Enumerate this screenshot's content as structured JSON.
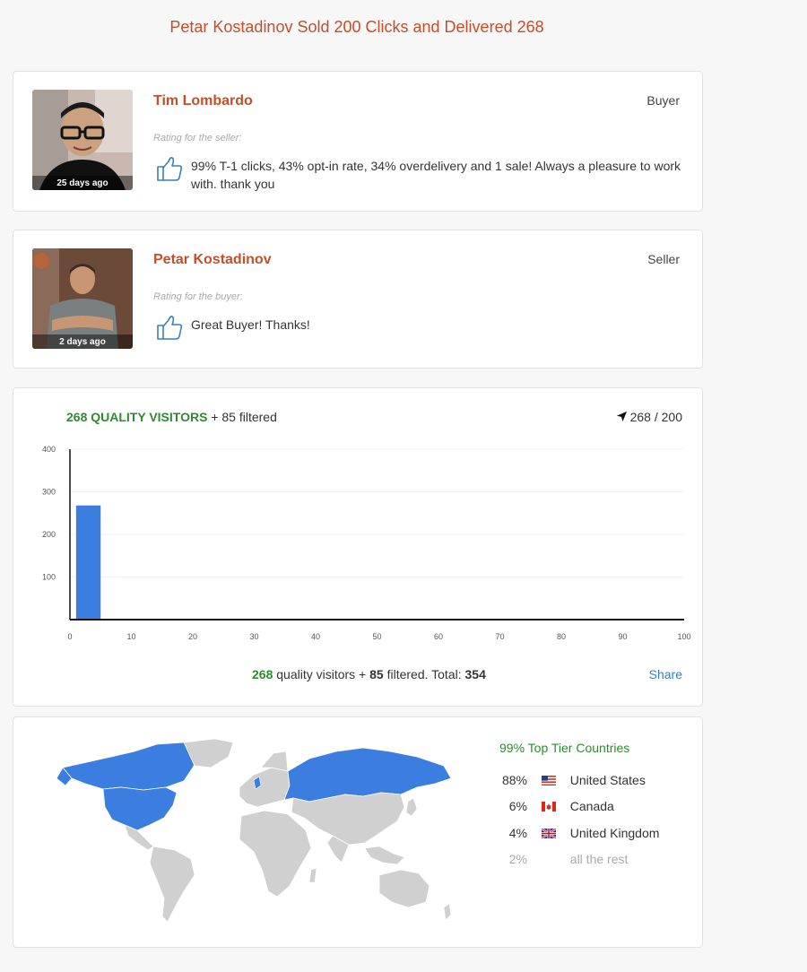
{
  "page": {
    "title": "Petar Kostadinov Sold 200 Clicks and Delivered 268"
  },
  "reviews": [
    {
      "name": "Tim Lombardo",
      "role": "Buyer",
      "time_ago": "25 days ago",
      "rating_label": "Rating for the seller:",
      "comment": "99% T-1 clicks, 43% opt-in rate, 34% overdelivery and 1 sale! Always a pleasure to work with. thank you",
      "rating_icon": "thumbs-up-icon"
    },
    {
      "name": "Petar Kostadinov",
      "role": "Seller",
      "time_ago": "2 days ago",
      "rating_label": "Rating for the buyer:",
      "comment": "Great Buyer! Thanks!",
      "rating_icon": "thumbs-up-icon"
    }
  ],
  "visitors": {
    "quality_label": "268 QUALITY VISITORS",
    "filtered_label": "+ 85 filtered",
    "delivered_label": "268 / 200",
    "footer": {
      "quality": "268",
      "quality_text": "quality visitors +",
      "filtered": "85",
      "filtered_text": "filtered. Total:",
      "total": "354"
    },
    "share_label": "Share"
  },
  "chart_data": {
    "type": "bar",
    "x": [
      3
    ],
    "values": [
      268
    ],
    "xlim": [
      0,
      100
    ],
    "ylim": [
      0,
      400
    ],
    "x_ticks": [
      "0",
      "10",
      "20",
      "30",
      "40",
      "50",
      "60",
      "70",
      "80",
      "90",
      "100"
    ],
    "y_ticks": [
      "100",
      "200",
      "300",
      "400"
    ],
    "bar_color": "#3c7ee0"
  },
  "geo": {
    "tier_title": "99% Top Tier Countries",
    "countries": [
      {
        "pct": "88%",
        "name": "United States",
        "flag": "us-flag-icon"
      },
      {
        "pct": "6%",
        "name": "Canada",
        "flag": "canada-flag-icon"
      },
      {
        "pct": "4%",
        "name": "United Kingdom",
        "flag": "uk-flag-icon"
      },
      {
        "pct": "2%",
        "name": "all the rest",
        "flag": ""
      }
    ],
    "highlight_color": "#3c7ee0",
    "base_color": "#d0d0d0"
  }
}
